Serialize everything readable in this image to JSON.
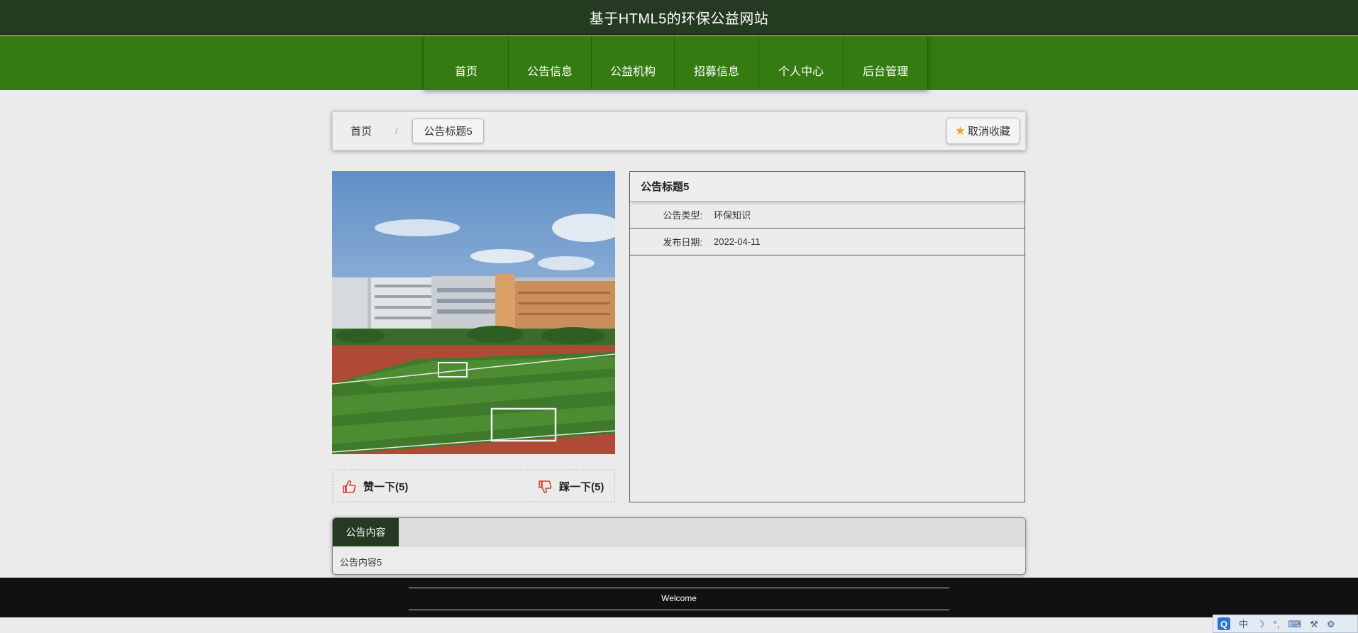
{
  "header": {
    "site_title": "基于HTML5的环保公益网站"
  },
  "nav": {
    "items": [
      {
        "label": "首页"
      },
      {
        "label": "公告信息"
      },
      {
        "label": "公益机构"
      },
      {
        "label": "招募信息"
      },
      {
        "label": "个人中心"
      },
      {
        "label": "后台管理"
      }
    ]
  },
  "breadcrumb": {
    "home": "首页",
    "separator": "/",
    "current": "公告标题5",
    "favorite_button": "取消收藏",
    "favorite_icon": "star-icon"
  },
  "detail": {
    "title": "公告标题5",
    "rows": [
      {
        "label": "公告类型:",
        "value": "环保知识"
      },
      {
        "label": "发布日期:",
        "value": "2022-04-11"
      }
    ]
  },
  "votes": {
    "like_label": "赞一下(5)",
    "dislike_label": "踩一下(5)",
    "like_icon": "thumbs-up-icon",
    "dislike_icon": "thumbs-down-icon"
  },
  "content": {
    "tab_label": "公告内容",
    "text": "公告内容5"
  },
  "footer": {
    "text": "Welcome"
  },
  "tray": {
    "q": "Q",
    "ime": "中",
    "moon": "☽",
    "dots": "°,",
    "keyboard": "⌨",
    "tools": "⚒",
    "wrench": "⚙"
  },
  "colors": {
    "header_bg": "#243b21",
    "nav_bg": "#347b12",
    "footer_bg": "#111111",
    "accent_red": "#d9432b",
    "star": "#f0a21b"
  }
}
